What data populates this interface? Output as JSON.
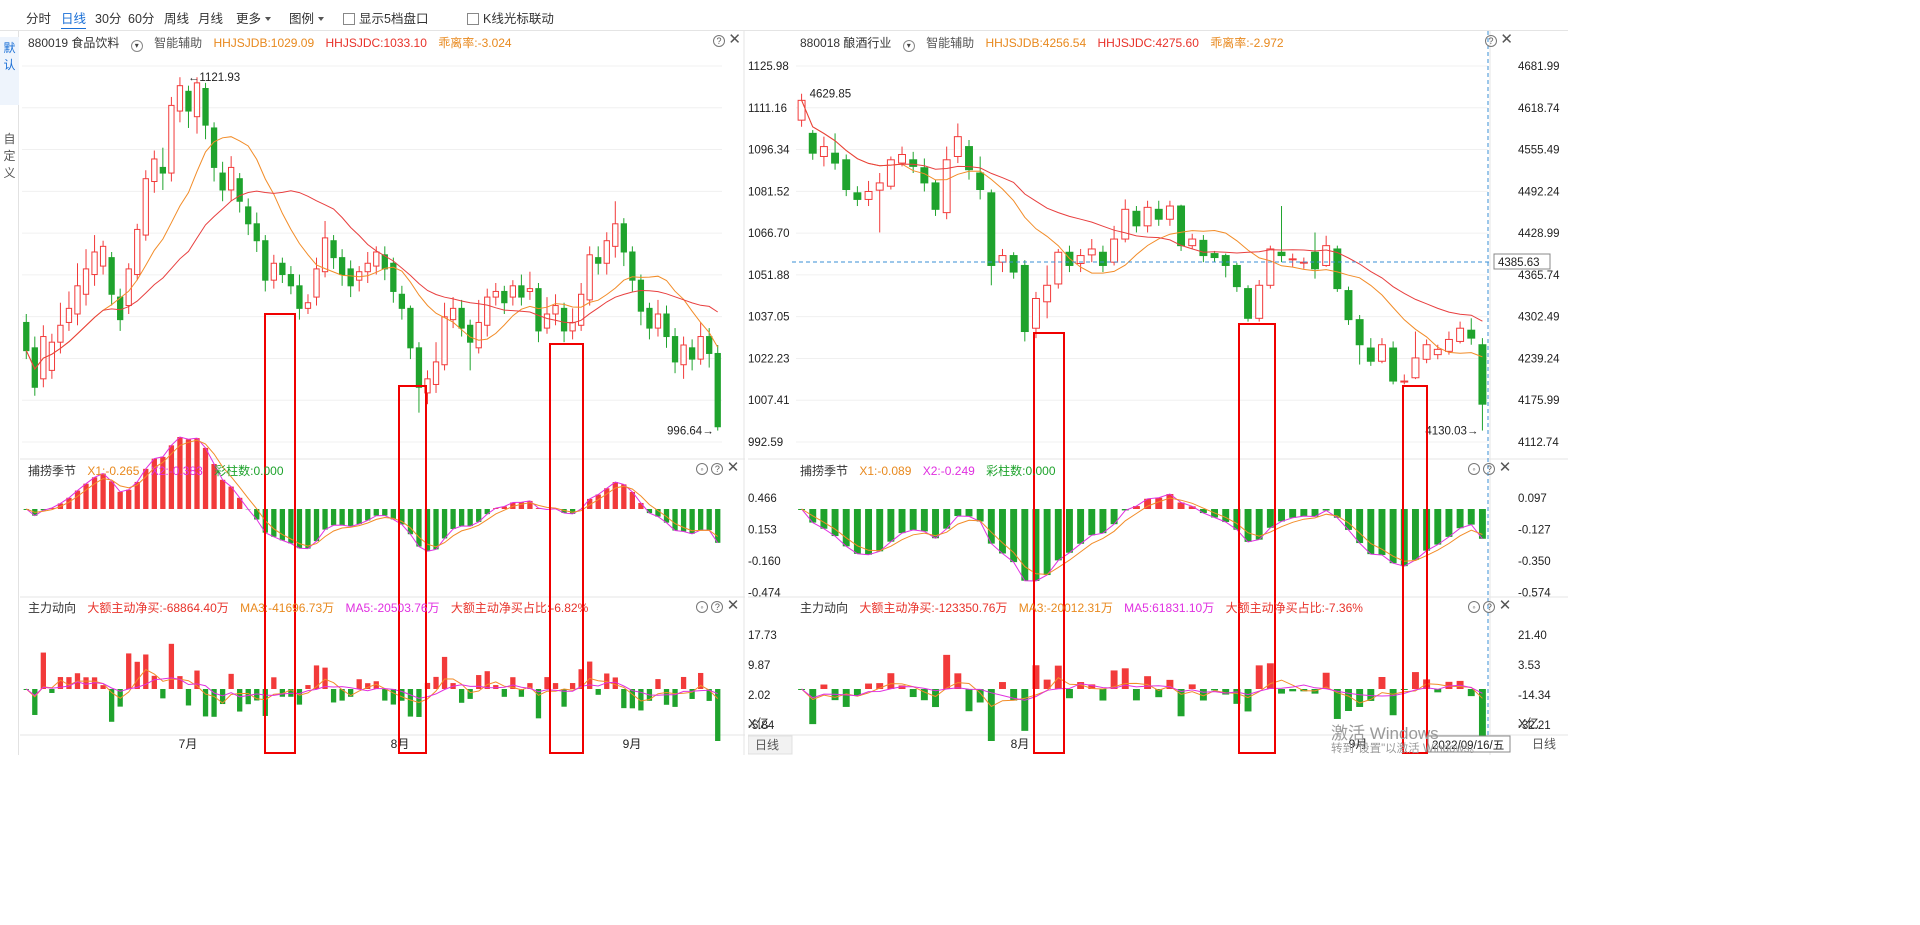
{
  "toolbar": {
    "items": [
      "分时",
      "日线",
      "30分",
      "60分",
      "周线",
      "月线",
      "更多",
      "图例"
    ],
    "active": "日线",
    "checkbox1": "显示5档盘口",
    "checkbox2": "K线光标联动"
  },
  "left_tabs": [
    "默认",
    "自定义"
  ],
  "panels": [
    {
      "code_name": "880019 食品饮料",
      "assist": "智能辅助",
      "hhjsjdb": "HHJSJDB:1029.09",
      "hhjsjdc": "HHJSJDC:1033.10",
      "deviation": "乖离率:-3.024",
      "osc_title": "捕捞季节",
      "osc_x1": "X1:-0.265",
      "osc_x2": "X2:-0.383",
      "osc_bars": "彩柱数:0.000",
      "flow_title": "主力动向",
      "flow_net": "大额主动净买:-68864.40万",
      "flow_ma3": "MA3:-41696.73万",
      "flow_ma5": "MA5:-20503.76万",
      "flow_ratio": "大额主动净买占比:-6.82%",
      "max_label": "1121.93",
      "min_label": "996.64",
      "price_ticks": [
        "1125.98",
        "1111.16",
        "1096.34",
        "1081.52",
        "1066.70",
        "1051.88",
        "1037.05",
        "1022.23",
        "1007.41",
        "992.59"
      ],
      "osc_ticks": [
        "0.466",
        "0.153",
        "-0.160",
        "-0.474"
      ],
      "flow_ticks": [
        "17.73",
        "9.87",
        "2.02",
        "-5.84"
      ],
      "flow_unit": "X亿",
      "period": "日线",
      "months": [
        "7月",
        "8月",
        "9月"
      ]
    },
    {
      "code_name": "880018 酿酒行业",
      "assist": "智能辅助",
      "hhjsjdb": "HHJSJDB:4256.54",
      "hhjsjdc": "HHJSJDC:4275.60",
      "deviation": "乖离率:-2.972",
      "osc_title": "捕捞季节",
      "osc_x1": "X1:-0.089",
      "osc_x2": "X2:-0.249",
      "osc_bars": "彩柱数:0.000",
      "flow_title": "主力动向",
      "flow_net": "大额主动净买:-123350.76万",
      "flow_ma3": "MA3:-20012.31万",
      "flow_ma5": "MA5:61831.10万",
      "flow_ratio": "大额主动净买占比:-7.36%",
      "max_label": "4629.85",
      "min_label": "4130.03",
      "crosshair_price": "4385.63",
      "date_label": "2022/09/16/五",
      "price_ticks": [
        "4681.99",
        "4618.74",
        "4555.49",
        "4492.24",
        "4428.99",
        "4365.74",
        "4302.49",
        "4239.24",
        "4175.99",
        "4112.74"
      ],
      "osc_ticks": [
        "0.097",
        "-0.127",
        "-0.350",
        "-0.574"
      ],
      "flow_ticks": [
        "21.40",
        "3.53",
        "-14.34",
        "-32.21"
      ],
      "flow_unit": "X亿",
      "period": "日线",
      "months": [
        "8月",
        "9月"
      ]
    }
  ],
  "watermark": {
    "line1": "激活 Windows",
    "line2": "转到\"设置\"以激活 Windows。"
  },
  "colors": {
    "up": "#f23a3a",
    "down": "#1fa32d",
    "ma_short": "#f28c28",
    "ma_long": "#e83f3f",
    "pink": "#e030e0",
    "box": "#f00000"
  },
  "chart_data": [
    {
      "type": "candlestick",
      "title": "880019 食品饮料",
      "ylim": [
        992.59,
        1125.98
      ],
      "candles": [
        [
          1035,
          1025,
          1038,
          1022
        ],
        [
          1026,
          1012,
          1030,
          1009
        ],
        [
          1015,
          1030,
          1034,
          1012
        ],
        [
          1018,
          1028,
          1031,
          1015
        ],
        [
          1028,
          1034,
          1042,
          1024
        ],
        [
          1035,
          1040,
          1046,
          1032
        ],
        [
          1038,
          1048,
          1056,
          1034
        ],
        [
          1045,
          1054,
          1061,
          1041
        ],
        [
          1052,
          1060,
          1066,
          1048
        ],
        [
          1055,
          1062,
          1064,
          1052
        ],
        [
          1058,
          1045,
          1060,
          1041
        ],
        [
          1044,
          1036,
          1047,
          1032
        ],
        [
          1041,
          1054,
          1056,
          1038
        ],
        [
          1052,
          1068,
          1070,
          1050
        ],
        [
          1066,
          1086,
          1089,
          1064
        ],
        [
          1085,
          1093,
          1096,
          1081
        ],
        [
          1090,
          1088,
          1097,
          1082
        ],
        [
          1088,
          1112,
          1115,
          1085
        ],
        [
          1110,
          1119,
          1122,
          1106
        ],
        [
          1117,
          1110,
          1119,
          1104
        ],
        [
          1108,
          1120,
          1122,
          1102
        ],
        [
          1118,
          1105,
          1120,
          1100
        ],
        [
          1104,
          1090,
          1106,
          1085
        ],
        [
          1088,
          1082,
          1092,
          1078
        ],
        [
          1082,
          1090,
          1094,
          1078
        ],
        [
          1086,
          1078,
          1088,
          1074
        ],
        [
          1076,
          1070,
          1079,
          1066
        ],
        [
          1070,
          1064,
          1074,
          1060
        ],
        [
          1064,
          1050,
          1066,
          1046
        ],
        [
          1050,
          1056,
          1059,
          1047
        ],
        [
          1056,
          1052,
          1058,
          1049
        ],
        [
          1052,
          1048,
          1055,
          1045
        ],
        [
          1048,
          1040,
          1052,
          1036
        ],
        [
          1040,
          1042,
          1045,
          1038
        ],
        [
          1044,
          1054,
          1058,
          1041
        ],
        [
          1053,
          1065,
          1071,
          1051
        ],
        [
          1064,
          1058,
          1066,
          1054
        ],
        [
          1058,
          1052,
          1061,
          1048
        ],
        [
          1054,
          1048,
          1057,
          1044
        ],
        [
          1050,
          1053,
          1055,
          1046
        ],
        [
          1053,
          1056,
          1060,
          1049
        ],
        [
          1055,
          1060,
          1062,
          1052
        ],
        [
          1059,
          1054,
          1062,
          1050
        ],
        [
          1056,
          1046,
          1058,
          1042
        ],
        [
          1045,
          1040,
          1048,
          1036
        ],
        [
          1040,
          1026,
          1041,
          1022
        ],
        [
          1026,
          1012,
          1028,
          1003
        ],
        [
          1010,
          1015,
          1018,
          1006
        ],
        [
          1013,
          1021,
          1028,
          1010
        ],
        [
          1020,
          1037,
          1042,
          1018
        ],
        [
          1036,
          1040,
          1044,
          1033
        ],
        [
          1040,
          1033,
          1043,
          1030
        ],
        [
          1034,
          1028,
          1036,
          1018
        ],
        [
          1026,
          1035,
          1043,
          1024
        ],
        [
          1034,
          1044,
          1047,
          1030
        ],
        [
          1044,
          1046,
          1049,
          1041
        ],
        [
          1046,
          1042,
          1048,
          1038
        ],
        [
          1044,
          1048,
          1050,
          1041
        ],
        [
          1048,
          1044,
          1052,
          1041
        ],
        [
          1046,
          1047,
          1053,
          1043
        ],
        [
          1047,
          1032,
          1049,
          1028
        ],
        [
          1033,
          1038,
          1044,
          1031
        ],
        [
          1038,
          1041,
          1045,
          1034
        ],
        [
          1040,
          1032,
          1042,
          1028
        ],
        [
          1032,
          1035,
          1040,
          1029
        ],
        [
          1034,
          1045,
          1049,
          1032
        ],
        [
          1043,
          1059,
          1062,
          1041
        ],
        [
          1058,
          1056,
          1062,
          1052
        ],
        [
          1056,
          1064,
          1067,
          1052
        ],
        [
          1062,
          1070,
          1078,
          1058
        ],
        [
          1070,
          1060,
          1072,
          1055
        ],
        [
          1060,
          1050,
          1062,
          1046
        ],
        [
          1050,
          1039,
          1052,
          1034
        ],
        [
          1040,
          1033,
          1042,
          1029
        ],
        [
          1033,
          1038,
          1043,
          1030
        ],
        [
          1038,
          1030,
          1041,
          1026
        ],
        [
          1030,
          1021,
          1033,
          1017
        ],
        [
          1020,
          1027,
          1030,
          1015
        ],
        [
          1026,
          1022,
          1029,
          1018
        ],
        [
          1022,
          1030,
          1035,
          1020
        ],
        [
          1030,
          1024,
          1033,
          1019
        ],
        [
          1024,
          998,
          1027,
          996.64
        ]
      ],
      "indicator": "捕捞季节",
      "flow": "主力动向"
    },
    {
      "type": "candlestick",
      "title": "880018 酿酒行业",
      "ylim": [
        4112.74,
        4681.99
      ],
      "candles": [
        [
          4600,
          4630,
          4640,
          4590
        ],
        [
          4580,
          4550,
          4585,
          4540
        ],
        [
          4545,
          4560,
          4575,
          4530
        ],
        [
          4550,
          4535,
          4580,
          4525
        ],
        [
          4540,
          4495,
          4548,
          4485
        ],
        [
          4490,
          4480,
          4500,
          4470
        ],
        [
          4480,
          4492,
          4508,
          4470
        ],
        [
          4494,
          4505,
          4520,
          4430
        ],
        [
          4500,
          4540,
          4545,
          4495
        ],
        [
          4535,
          4548,
          4560,
          4530
        ],
        [
          4540,
          4530,
          4552,
          4520
        ],
        [
          4528,
          4505,
          4542,
          4492
        ],
        [
          4505,
          4465,
          4510,
          4455
        ],
        [
          4460,
          4540,
          4560,
          4450
        ],
        [
          4545,
          4575,
          4595,
          4535
        ],
        [
          4560,
          4525,
          4570,
          4510
        ],
        [
          4520,
          4495,
          4545,
          4480
        ],
        [
          4490,
          4380,
          4495,
          4350
        ],
        [
          4385,
          4395,
          4405,
          4370
        ],
        [
          4395,
          4370,
          4400,
          4360
        ],
        [
          4380,
          4280,
          4388,
          4265
        ],
        [
          4285,
          4330,
          4340,
          4270
        ],
        [
          4325,
          4350,
          4380,
          4300
        ],
        [
          4352,
          4400,
          4405,
          4345
        ],
        [
          4400,
          4380,
          4410,
          4370
        ],
        [
          4383,
          4395,
          4405,
          4370
        ],
        [
          4396,
          4405,
          4420,
          4385
        ],
        [
          4400,
          4380,
          4410,
          4370
        ],
        [
          4385,
          4420,
          4440,
          4380
        ],
        [
          4420,
          4465,
          4480,
          4415
        ],
        [
          4462,
          4440,
          4470,
          4430
        ],
        [
          4440,
          4468,
          4478,
          4430
        ],
        [
          4465,
          4450,
          4478,
          4440
        ],
        [
          4450,
          4470,
          4478,
          4440
        ],
        [
          4470,
          4410,
          4472,
          4402
        ],
        [
          4410,
          4420,
          4428,
          4405
        ],
        [
          4418,
          4395,
          4426,
          4385
        ],
        [
          4398,
          4392,
          4402,
          4385
        ],
        [
          4395,
          4380,
          4398,
          4362
        ],
        [
          4380,
          4348,
          4384,
          4340
        ],
        [
          4345,
          4300,
          4350,
          4295
        ],
        [
          4300,
          4350,
          4358,
          4295
        ],
        [
          4350,
          4405,
          4410,
          4345
        ],
        [
          4400,
          4395,
          4470,
          4385
        ],
        [
          4390,
          4390,
          4398,
          4378
        ],
        [
          4385,
          4385,
          4392,
          4375
        ],
        [
          4400,
          4375,
          4430,
          4360
        ],
        [
          4380,
          4410,
          4425,
          4378
        ],
        [
          4405,
          4345,
          4410,
          4340
        ],
        [
          4342,
          4298,
          4348,
          4290
        ],
        [
          4298,
          4260,
          4305,
          4230
        ],
        [
          4255,
          4235,
          4270,
          4228
        ],
        [
          4235,
          4260,
          4270,
          4232
        ],
        [
          4255,
          4205,
          4265,
          4200
        ],
        [
          4205,
          4205,
          4215,
          4200
        ],
        [
          4210,
          4240,
          4280,
          4208
        ],
        [
          4238,
          4260,
          4268,
          4232
        ],
        [
          4245,
          4253,
          4260,
          4238
        ],
        [
          4250,
          4268,
          4280,
          4245
        ],
        [
          4265,
          4285,
          4295,
          4262
        ],
        [
          4282,
          4270,
          4300,
          4260
        ],
        [
          4260,
          4170,
          4270,
          4130.03
        ]
      ],
      "indicator": "捕捞季节",
      "flow": "主力动向"
    }
  ]
}
